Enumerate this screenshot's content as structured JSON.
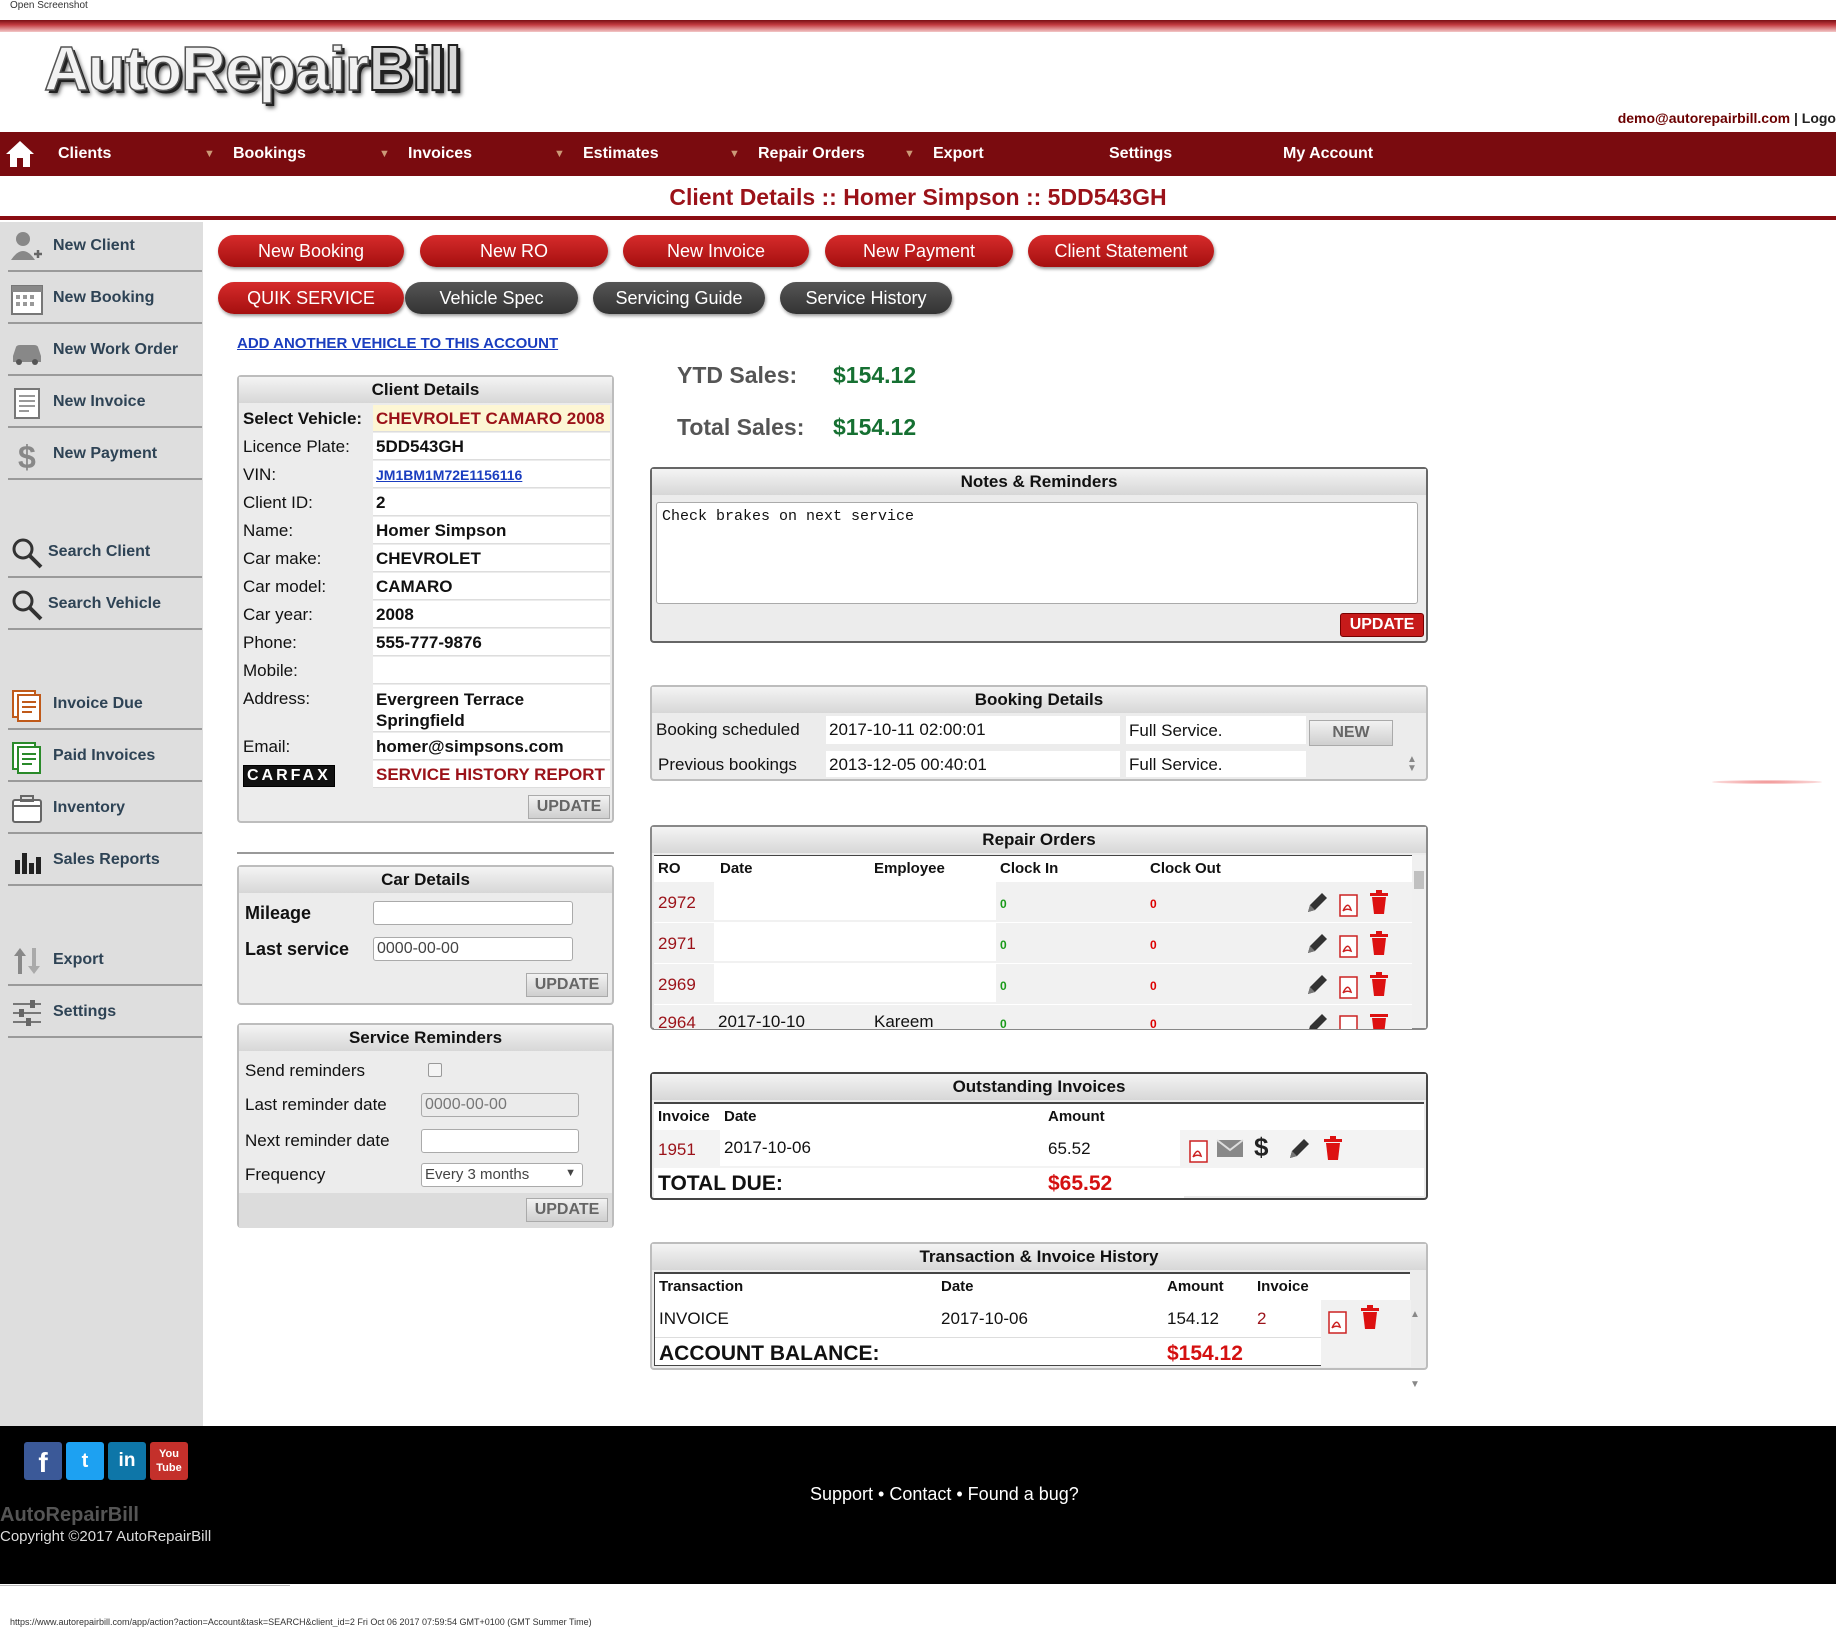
{
  "window": {
    "label": "Open Screenshot",
    "status_url": "https://www.autorepairbill.com/app/action?action=Account&task=SEARCH&client_id=2 Fri Oct 06 2017 07:59:54 GMT+0100 (GMT Summer Time)"
  },
  "brand": {
    "logo_part1": "AutoRepair",
    "logo_part2": "Bill"
  },
  "user": {
    "email": "demo@autorepairbill.com",
    "sep": " | ",
    "logout": "Logo"
  },
  "nav": [
    "Clients",
    "Bookings",
    "Invoices",
    "Estimates",
    "Repair Orders",
    "Export",
    "Settings",
    "My Account"
  ],
  "page_title": "Client Details :: Homer Simpson :: 5DD543GH",
  "sidebar": {
    "items": [
      "New Client",
      "New Booking",
      "New Work Order",
      "New Invoice",
      "New Payment",
      "Search Client",
      "Search Vehicle",
      "Invoice Due",
      "Paid Invoices",
      "Inventory",
      "Sales Reports",
      "Export",
      "Settings"
    ]
  },
  "actions_row1": [
    "New Booking",
    "New RO",
    "New Invoice",
    "New Payment",
    "Client Statement"
  ],
  "actions_row2": [
    "QUIK SERVICE",
    "Vehicle Spec",
    "Servicing Guide",
    "Service History"
  ],
  "add_vehicle_link": "ADD ANOTHER VEHICLE TO THIS ACCOUNT",
  "client_details": {
    "title": "Client Details",
    "rows": [
      {
        "k": "Select Vehicle:",
        "v": "CHEVROLET CAMARO 2008"
      },
      {
        "k": "Licence Plate:",
        "v": "5DD543GH"
      },
      {
        "k": "VIN:",
        "v": "JM1BM1M72E1156116"
      },
      {
        "k": "Client ID:",
        "v": "2"
      },
      {
        "k": "Name:",
        "v": "Homer Simpson"
      },
      {
        "k": "Car make:",
        "v": "CHEVROLET"
      },
      {
        "k": "Car model:",
        "v": "CAMARO"
      },
      {
        "k": "Car year:",
        "v": "2008"
      },
      {
        "k": "Phone:",
        "v": "555-777-9876"
      },
      {
        "k": "Mobile:",
        "v": ""
      },
      {
        "k": "Address:",
        "v": "Evergreen Terrace Springfield"
      },
      {
        "k": "Email:",
        "v": "homer@simpsons.com"
      }
    ],
    "carfax": "CARFAX",
    "service_history_report": "SERVICE HISTORY REPORT",
    "update": "UPDATE"
  },
  "car_details": {
    "title": "Car Details",
    "mileage_label": "Mileage",
    "mileage": "",
    "last_service_label": "Last service",
    "last_service": "0000-00-00",
    "update": "UPDATE"
  },
  "service_reminders": {
    "title": "Service Reminders",
    "send_label": "Send reminders",
    "last_label": "Last reminder date",
    "last_value": "0000-00-00",
    "next_label": "Next reminder date",
    "next_value": "",
    "freq_label": "Frequency",
    "freq_value": "Every 3 months",
    "update": "UPDATE"
  },
  "sales": {
    "ytd_label": "YTD Sales:",
    "ytd_value": "$154.12",
    "total_label": "Total Sales:",
    "total_value": "$154.12"
  },
  "notes": {
    "title": "Notes & Reminders",
    "text": "Check brakes on next service",
    "update": "UPDATE"
  },
  "booking": {
    "title": "Booking Details",
    "scheduled_label": "Booking scheduled",
    "scheduled_date": "2017-10-11 02:00:01",
    "scheduled_desc": "Full Service.",
    "new_btn": "NEW",
    "previous_label": "Previous bookings",
    "previous_date": "2013-12-05 00:40:01",
    "previous_desc": "Full Service."
  },
  "repair_orders": {
    "title": "Repair Orders",
    "headers": [
      "RO",
      "Date",
      "Employee",
      "Clock In",
      "Clock Out"
    ],
    "rows": [
      {
        "ro": "2972",
        "date": "",
        "emp": "",
        "in": "0",
        "out": "0"
      },
      {
        "ro": "2971",
        "date": "",
        "emp": "",
        "in": "0",
        "out": "0"
      },
      {
        "ro": "2969",
        "date": "",
        "emp": "",
        "in": "0",
        "out": "0"
      },
      {
        "ro": "2964",
        "date": "2017-10-10",
        "emp": "Kareem",
        "in": "0",
        "out": "0"
      }
    ]
  },
  "outstanding": {
    "title": "Outstanding Invoices",
    "headers": [
      "Invoice",
      "Date",
      "Amount"
    ],
    "row": {
      "invoice": "1951",
      "date": "2017-10-06",
      "amount": "65.52"
    },
    "total_label": "TOTAL DUE:",
    "total_value": "$65.52"
  },
  "history": {
    "title": "Transaction & Invoice History",
    "headers": [
      "Transaction",
      "Date",
      "Amount",
      "Invoice"
    ],
    "row": {
      "type": "INVOICE",
      "date": "2017-10-06",
      "amount": "154.12",
      "invoice": "2"
    },
    "balance_label": "ACCOUNT BALANCE:",
    "balance_value": "$154.12"
  },
  "footer": {
    "social": [
      "f",
      "t",
      "in",
      "You Tube"
    ],
    "links": "Support • Contact • Found a bug?",
    "brand": "AutoRepairBill",
    "copyright": "Copyright ©2017 AutoRepairBill"
  },
  "colors": {
    "brand_red": "#7a0b0f",
    "accent_red": "#9b1219",
    "green": "#167032"
  }
}
